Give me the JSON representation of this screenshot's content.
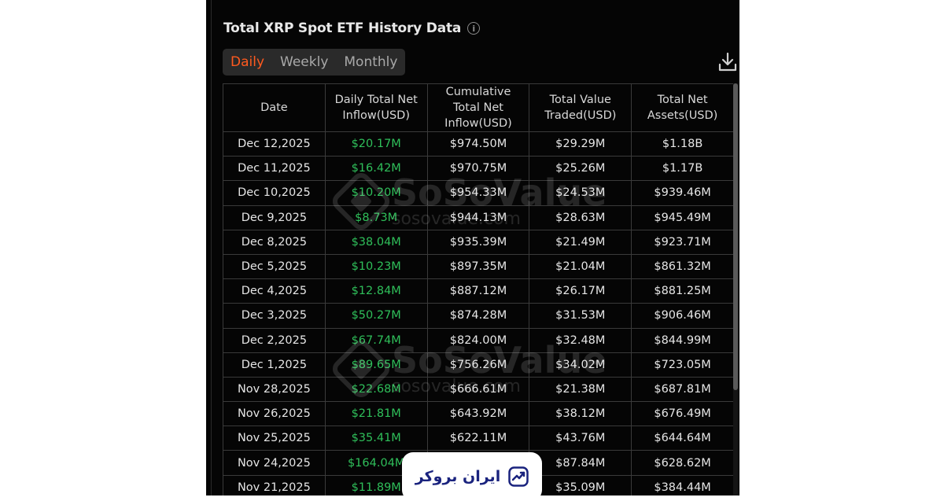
{
  "header": {
    "title": "Total XRP Spot ETF History Data",
    "info_glyph": "i"
  },
  "tabs": [
    {
      "label": "Daily",
      "active": true
    },
    {
      "label": "Weekly",
      "active": false
    },
    {
      "label": "Monthly",
      "active": false
    }
  ],
  "toolbar": {
    "download_icon": "download-icon"
  },
  "table": {
    "columns": [
      "Date",
      "Daily Total Net Inflow(USD)",
      "Cumulative Total Net Inflow(USD)",
      "Total Value Traded(USD)",
      "Total Net Assets(USD)"
    ],
    "rows": [
      [
        "Dec 12,2025",
        "$20.17M",
        "$974.50M",
        "$29.29M",
        "$1.18B"
      ],
      [
        "Dec 11,2025",
        "$16.42M",
        "$970.75M",
        "$25.26M",
        "$1.17B"
      ],
      [
        "Dec 10,2025",
        "$10.20M",
        "$954.33M",
        "$24.53M",
        "$939.46M"
      ],
      [
        "Dec 9,2025",
        "$8.73M",
        "$944.13M",
        "$28.63M",
        "$945.49M"
      ],
      [
        "Dec 8,2025",
        "$38.04M",
        "$935.39M",
        "$21.49M",
        "$923.71M"
      ],
      [
        "Dec 5,2025",
        "$10.23M",
        "$897.35M",
        "$21.04M",
        "$861.32M"
      ],
      [
        "Dec 4,2025",
        "$12.84M",
        "$887.12M",
        "$26.17M",
        "$881.25M"
      ],
      [
        "Dec 3,2025",
        "$50.27M",
        "$874.28M",
        "$31.53M",
        "$906.46M"
      ],
      [
        "Dec 2,2025",
        "$67.74M",
        "$824.00M",
        "$32.48M",
        "$844.99M"
      ],
      [
        "Dec 1,2025",
        "$89.65M",
        "$756.26M",
        "$34.02M",
        "$723.05M"
      ],
      [
        "Nov 28,2025",
        "$22.68M",
        "$666.61M",
        "$21.38M",
        "$687.81M"
      ],
      [
        "Nov 26,2025",
        "$21.81M",
        "$643.92M",
        "$38.12M",
        "$676.49M"
      ],
      [
        "Nov 25,2025",
        "$35.41M",
        "$622.11M",
        "$43.76M",
        "$644.64M"
      ],
      [
        "Nov 24,2025",
        "$164.04M",
        "",
        "$87.84M",
        "$628.62M"
      ],
      [
        "Nov 21,2025",
        "$11.89M",
        "",
        "$35.09M",
        "$384.44M"
      ]
    ]
  },
  "watermark": {
    "name": "SoSoValue",
    "site": "sosovalue.com"
  },
  "badge": {
    "text": "ایران بروکر"
  },
  "colors": {
    "background": "#050505",
    "accent_active_tab": "#ff5a1f",
    "inflow_positive": "#2fbf5a",
    "grid": "#3a3a3a"
  }
}
